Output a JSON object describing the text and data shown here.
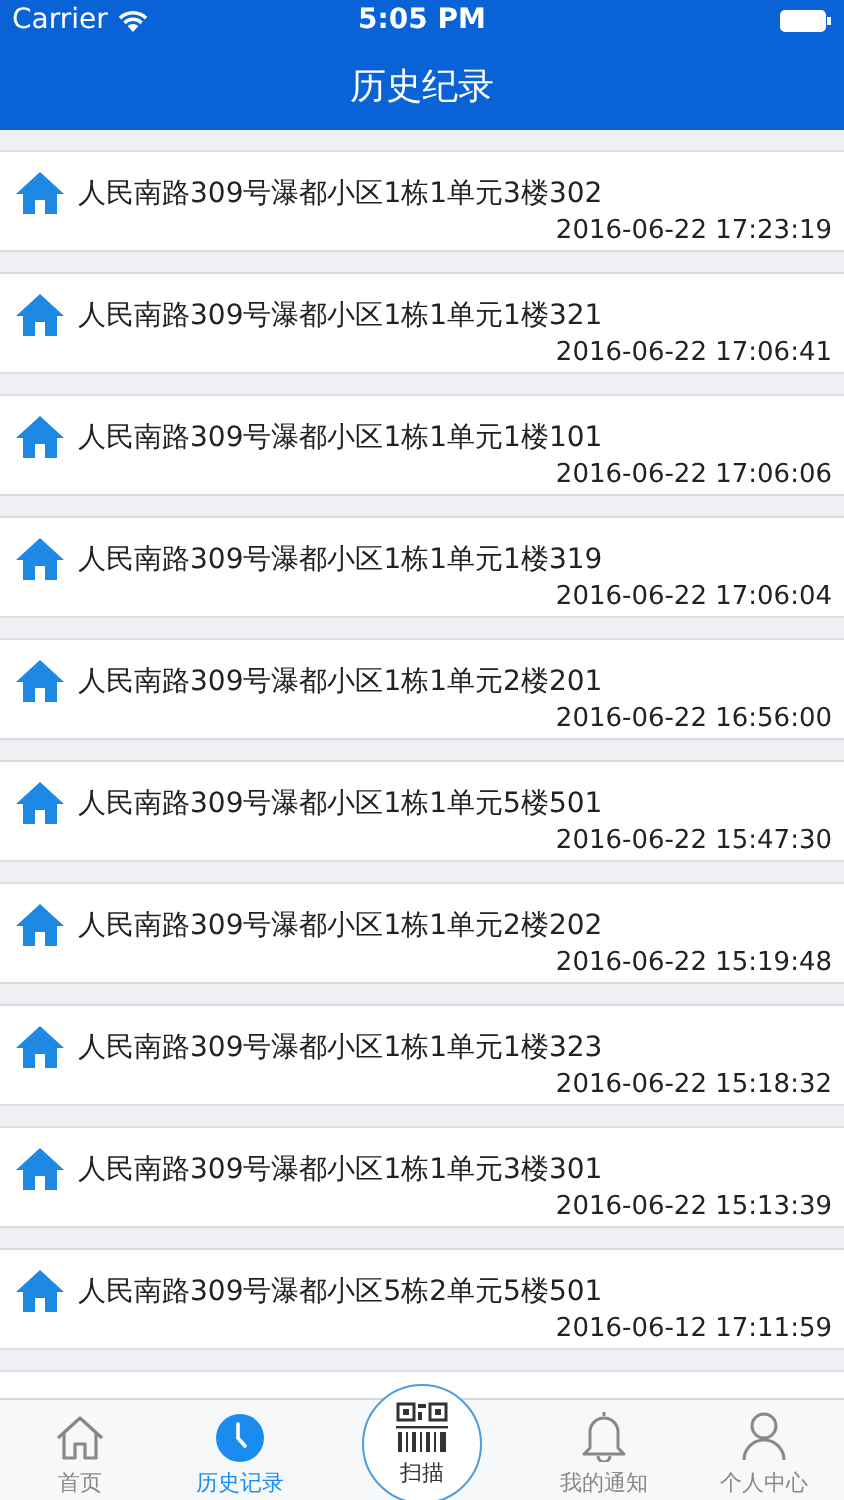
{
  "status_bar": {
    "carrier": "Carrier",
    "time": "5:05 PM"
  },
  "nav_bar": {
    "title": "历史纪录"
  },
  "history": [
    {
      "address": "人民南路309号瀑都小区1栋1单元3楼302",
      "time": "2016-06-22 17:23:19"
    },
    {
      "address": "人民南路309号瀑都小区1栋1单元1楼321",
      "time": "2016-06-22 17:06:41"
    },
    {
      "address": "人民南路309号瀑都小区1栋1单元1楼101",
      "time": "2016-06-22 17:06:06"
    },
    {
      "address": "人民南路309号瀑都小区1栋1单元1楼319",
      "time": "2016-06-22 17:06:04"
    },
    {
      "address": "人民南路309号瀑都小区1栋1单元2楼201",
      "time": "2016-06-22 16:56:00"
    },
    {
      "address": "人民南路309号瀑都小区1栋1单元5楼501",
      "time": "2016-06-22 15:47:30"
    },
    {
      "address": "人民南路309号瀑都小区1栋1单元2楼202",
      "time": "2016-06-22 15:19:48"
    },
    {
      "address": "人民南路309号瀑都小区1栋1单元1楼323",
      "time": "2016-06-22 15:18:32"
    },
    {
      "address": "人民南路309号瀑都小区1栋1单元3楼301",
      "time": "2016-06-22 15:13:39"
    },
    {
      "address": "人民南路309号瀑都小区5栋2单元5楼501",
      "time": "2016-06-12 17:11:59"
    }
  ],
  "tab_bar": [
    {
      "kind": "home",
      "label": "首页",
      "selected": false
    },
    {
      "kind": "history",
      "label": "历史记录",
      "selected": true
    },
    {
      "kind": "scan",
      "label": "扫描",
      "selected": false
    },
    {
      "kind": "notice",
      "label": "我的通知",
      "selected": false
    },
    {
      "kind": "profile",
      "label": "个人中心",
      "selected": false
    }
  ]
}
